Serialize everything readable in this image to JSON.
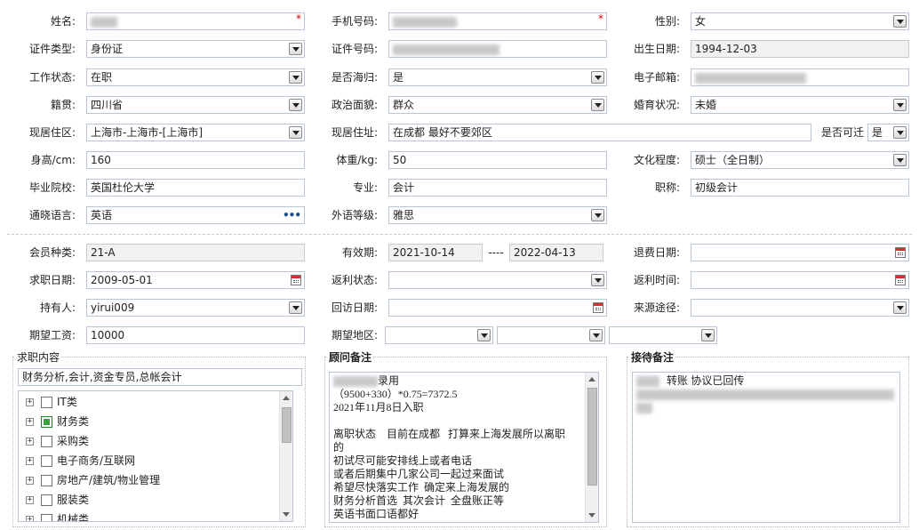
{
  "form": {
    "name_label": "姓名:",
    "phone_label": "手机号码:",
    "gender_label": "性别:",
    "gender_value": "女",
    "id_type_label": "证件类型:",
    "id_type_value": "身份证",
    "id_number_label": "证件号码:",
    "birth_label": "出生日期:",
    "birth_value": "1994-12-03",
    "work_status_label": "工作状态:",
    "work_status_value": "在职",
    "overseas_label": "是否海归:",
    "overseas_value": "是",
    "email_label": "电子邮箱:",
    "native_label": "籍贯:",
    "native_value": "四川省",
    "political_label": "政治面貌:",
    "political_value": "群众",
    "marital_label": "婚育状况:",
    "marital_value": "未婚",
    "residence_area_label": "现居住区:",
    "residence_area_value": "上海市-上海市-[上海市]",
    "residence_addr_label": "现居住址:",
    "residence_addr_value": "在成都 最好不要郊区",
    "relocate_label": "是否可迁",
    "relocate_value": "是",
    "height_label": "身高/cm:",
    "height_value": "160",
    "weight_label": "体重/kg:",
    "weight_value": "50",
    "education_label": "文化程度:",
    "education_value": "硕士（全日制）",
    "school_label": "毕业院校:",
    "school_value": "英国杜伦大学",
    "major_label": "专业:",
    "major_value": "会计",
    "title_label": "职称:",
    "title_value": "初级会计",
    "language_label": "通晓语言:",
    "language_value": "英语",
    "foreign_level_label": "外语等级:",
    "foreign_level_value": "雅思"
  },
  "membership": {
    "type_label": "会员种类:",
    "type_value": "21-A",
    "valid_label": "有效期:",
    "valid_from": "2021-10-14",
    "valid_dash": "----",
    "valid_to": "2022-04-13",
    "refund_date_label": "退费日期:",
    "job_date_label": "求职日期:",
    "job_date_value": "2009-05-01",
    "rebate_status_label": "返利状态:",
    "rebate_time_label": "返利时间:",
    "holder_label": "持有人:",
    "holder_value": "yirui009",
    "revisit_label": "回访日期:",
    "source_label": "来源途径:",
    "salary_label": "期望工资:",
    "salary_value": "10000",
    "region_label": "期望地区:"
  },
  "job_panel": {
    "title": "求职内容",
    "selected": "财务分析,会计,资金专员,总帐会计",
    "items": [
      {
        "label": "IT类",
        "checked": false
      },
      {
        "label": "财务类",
        "checked": true
      },
      {
        "label": "采购类",
        "checked": false
      },
      {
        "label": "电子商务/互联网",
        "checked": false
      },
      {
        "label": "房地产/建筑/物业管理",
        "checked": false
      },
      {
        "label": "服装类",
        "checked": false
      },
      {
        "label": "机械类",
        "checked": false
      }
    ]
  },
  "advisor_panel": {
    "title": "顾问备注",
    "line1_suffix": "录用",
    "lines": [
      "（9500+330）*0.75=7372.5",
      "2021年11月8日入职",
      "",
      "离职状态    目前在成都   打算来上海发展所以离职",
      "的",
      "初试尽可能安排线上或者电话",
      "或者后期集中几家公司一起过来面试",
      "希望尽快落实工作  确定来上海发展的",
      "财务分析首选  其次会计  全盘账正等",
      "英语书面口语都好"
    ]
  },
  "reception_panel": {
    "title": "接待备注",
    "line1_suffix": "转账  协议已回传"
  },
  "icons": {
    "dropdown": "chevron-down-icon",
    "calendar": "calendar-icon",
    "ellipsis": "more-icon",
    "required": "required-asterisk-icon",
    "expand": "expand-plus-icon"
  },
  "colors": {
    "field_border": "#b9c6d6",
    "readonly_bg": "#f1f1f1",
    "required": "#dd0000",
    "checked": "#3aa43a"
  }
}
